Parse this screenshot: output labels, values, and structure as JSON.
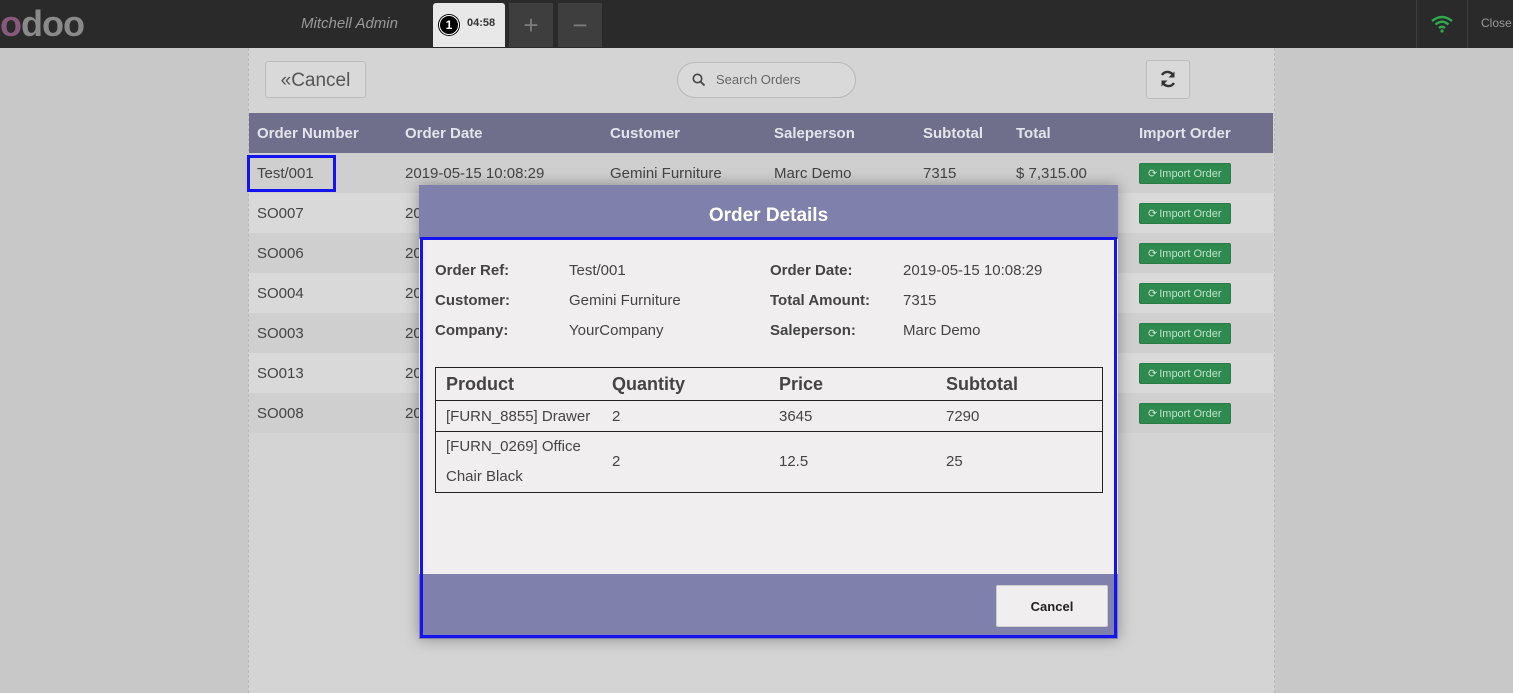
{
  "app": {
    "logo_text": "odoo",
    "username": "Mitchell Admin",
    "order_tab": {
      "number": "1",
      "time": "04:58"
    },
    "add_tab": "+",
    "remove_tab": "−",
    "close_label": "Close"
  },
  "toolbar": {
    "cancel_label": "Cancel",
    "search_placeholder": "Search Orders"
  },
  "orders_table": {
    "headers": [
      "Order Number",
      "Order Date",
      "Customer",
      "Saleperson",
      "Subtotal",
      "Total",
      "Import Order"
    ],
    "import_label": "Import Order",
    "rows": [
      {
        "number": "Test/001",
        "date": "2019-05-15 10:08:29",
        "customer": "Gemini Furniture",
        "saleperson": "Marc Demo",
        "subtotal": "7315",
        "total": "$ 7,315.00"
      },
      {
        "number": "SO007",
        "date": "20"
      },
      {
        "number": "SO006",
        "date": "20"
      },
      {
        "number": "SO004",
        "date": "20"
      },
      {
        "number": "SO003",
        "date": "20"
      },
      {
        "number": "SO013",
        "date": "20"
      },
      {
        "number": "SO008",
        "date": "20"
      }
    ]
  },
  "modal": {
    "title": "Order Details",
    "fields": {
      "order_ref_label": "Order Ref:",
      "order_ref": "Test/001",
      "customer_label": "Customer:",
      "customer": "Gemini Furniture",
      "company_label": "Company:",
      "company": "YourCompany",
      "order_date_label": "Order Date:",
      "order_date": "2019-05-15 10:08:29",
      "total_amount_label": "Total Amount:",
      "total_amount": "7315",
      "saleperson_label": "Saleperson:",
      "saleperson": "Marc Demo"
    },
    "lines_headers": [
      "Product",
      "Quantity",
      "Price",
      "Subtotal"
    ],
    "lines": [
      {
        "product": "[FURN_8855] Drawer",
        "quantity": "2",
        "price": "3645",
        "subtotal": "7290"
      },
      {
        "product": "[FURN_0269] Office Chair Black",
        "quantity": "2",
        "price": "12.5",
        "subtotal": "25"
      }
    ],
    "cancel_label": "Cancel"
  },
  "colors": {
    "header_bar": "#2a2a2a",
    "table_header": "#6f6f8c",
    "modal_header": "#7f80ab",
    "import_button": "#2e8a4e",
    "highlight": "#1414f0"
  }
}
